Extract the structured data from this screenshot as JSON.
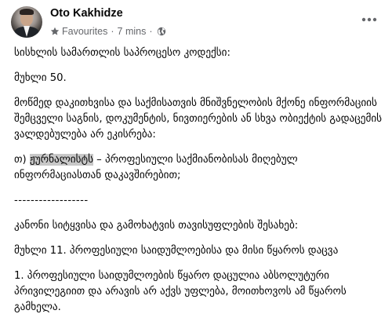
{
  "post": {
    "author": "Oto Kakhidze",
    "audience": "Favourites",
    "separator": "·",
    "time": "7 mins",
    "more_label": "···"
  },
  "icons": {
    "star": "star-icon",
    "globe": "globe-icon",
    "more": "more-options-icon"
  },
  "colors": {
    "meta_text": "#65676b",
    "highlight": "#c8c8c8"
  },
  "body": {
    "p1": "სისხლის სამართლის საპროცესო კოდექსი:",
    "p2": "მუხლი 50.",
    "p3": "მოწმედ დაკითხვისა და საქმისათვის მნიშვნელობის მქონე ინფორმაციის შემცველი საგნის, დოკუმენტის, ნივთიერების ან სხვა ობიექტის გადაცემის ვალდებულება არ ეკისრება:",
    "p4_prefix": "თ) ",
    "p4_highlight": "ჟურნალისტს",
    "p4_suffix": " – პროფესიული საქმიანობისას მიღებულ ინფორმაციასთან დაკავშირებით;",
    "divider": "------------------",
    "p5": "კანონი სიტყვისა და გამოხატვის თავისუფლების შესახებ:",
    "p6": "მუხლი 11. პროფესიული საიდუმლოებისა და მისი წყაროს დაცვა",
    "p7": "1. პროფესიული საიდუმლოების წყარო დაცულია აბსოლუტური პრივილეგიით და არავის არ აქვს უფლება, მოითხოვოს ამ წყაროს გამხელა."
  }
}
